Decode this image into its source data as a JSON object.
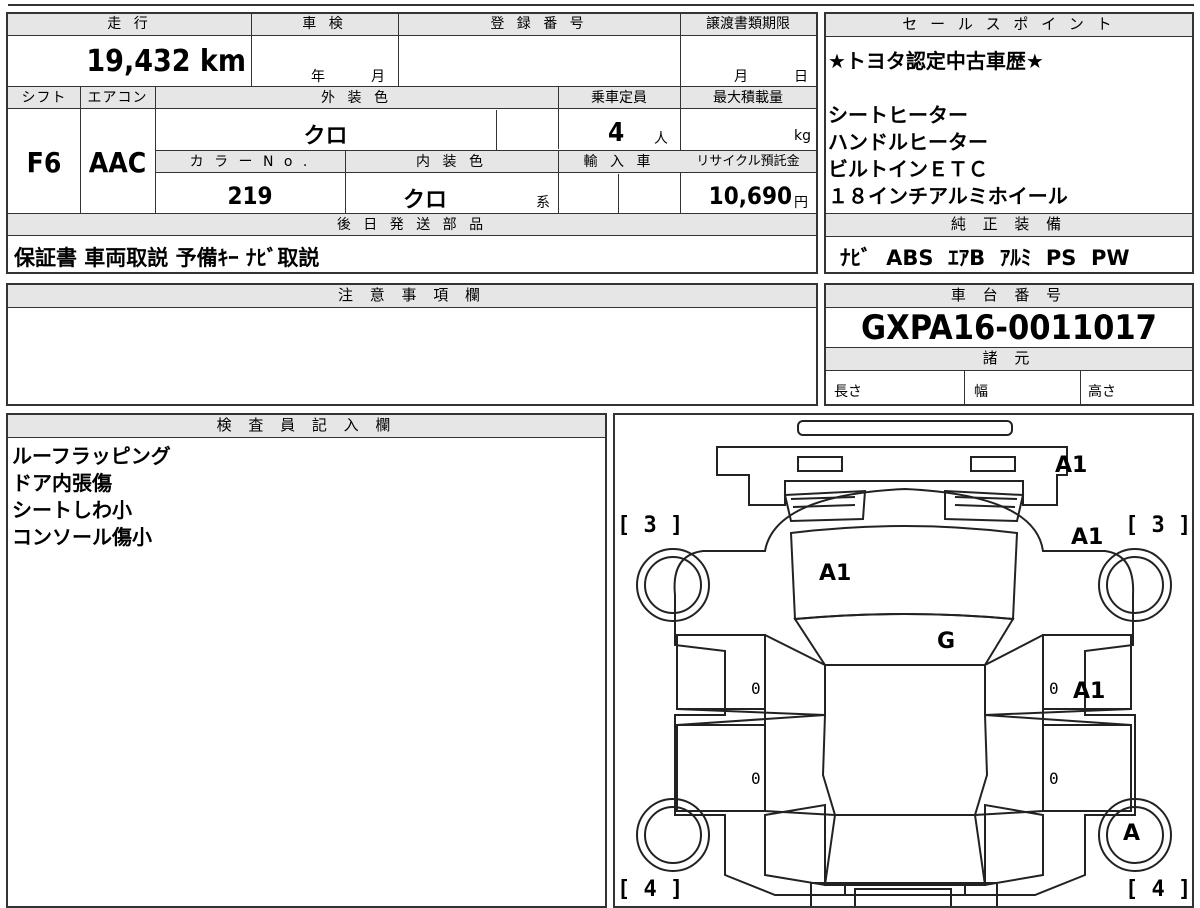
{
  "top_fields": {
    "mileage_label": "走 行",
    "mileage_value": "19,432 km",
    "inspection_label": "車 検",
    "inspection_year_unit": "年",
    "inspection_month_unit": "月",
    "registration_label": "登 録 番 号",
    "transfer_deadline_label": "譲渡書類期限",
    "transfer_month_unit": "月",
    "transfer_day_unit": "日",
    "shift_label": "シフト",
    "shift_value": "F6",
    "aircon_label": "エアコン",
    "aircon_value": "AAC",
    "exterior_color_label": "外 装 色",
    "exterior_color_value": "クロ",
    "capacity_label": "乗車定員",
    "capacity_value": "4",
    "capacity_unit": "人",
    "max_load_label": "最大積載量",
    "max_load_unit": "kg",
    "color_no_label": "カ ラ ー N o .",
    "color_no_value": "219",
    "interior_color_label": "内 装 色",
    "interior_color_value": "クロ",
    "interior_color_unit": "系",
    "import_label": "輸 入 車",
    "recycle_label": "リサイクル預託金",
    "recycle_value": "10,690",
    "recycle_unit": "円",
    "later_parts_label": "後 日 発 送 部 品",
    "later_parts_value": "保証書 車両取説 予備ｷｰ ﾅﾋﾞ取説"
  },
  "sales_points": {
    "label": "セ ー ル ス ポ イ ン ト",
    "lines": [
      "★トヨタ認定中古車歴★",
      "",
      "シートヒーター",
      "ハンドルヒーター",
      "ビルトインＥＴＣ",
      "１８インチアルミホイール"
    ]
  },
  "standard_equipment": {
    "label": "純 正 装 備",
    "value": "ﾅﾋﾞ  ABS  ｴｱB  ｱﾙﾐ  PS  PW"
  },
  "notes": {
    "label": "注 意 事 項 欄"
  },
  "chassis": {
    "label": "車 台 番 号",
    "value": "GXPA16-0011017",
    "specs_label": "諸 元",
    "length_label": "長さ",
    "width_label": "幅",
    "height_label": "高さ"
  },
  "inspector": {
    "label": "検 査 員 記 入 欄",
    "lines": [
      "ルーフラッピング",
      "ドア内張傷",
      "シートしわ小",
      "コンソール傷小"
    ]
  },
  "diagram": {
    "marks": {
      "rear_right": "A1",
      "right_front_fender": "A1",
      "hood": "A1",
      "windshield": "G",
      "right_front_door": "A1",
      "right_rear_wheel": "A"
    },
    "tire_scores": {
      "front_left": "[ 3 ]",
      "front_right": "[ 3 ]",
      "rear_left": "[ 4 ]",
      "rear_right": "[ 4 ]"
    },
    "door_zeros": [
      "0",
      "0",
      "0",
      "0"
    ]
  }
}
